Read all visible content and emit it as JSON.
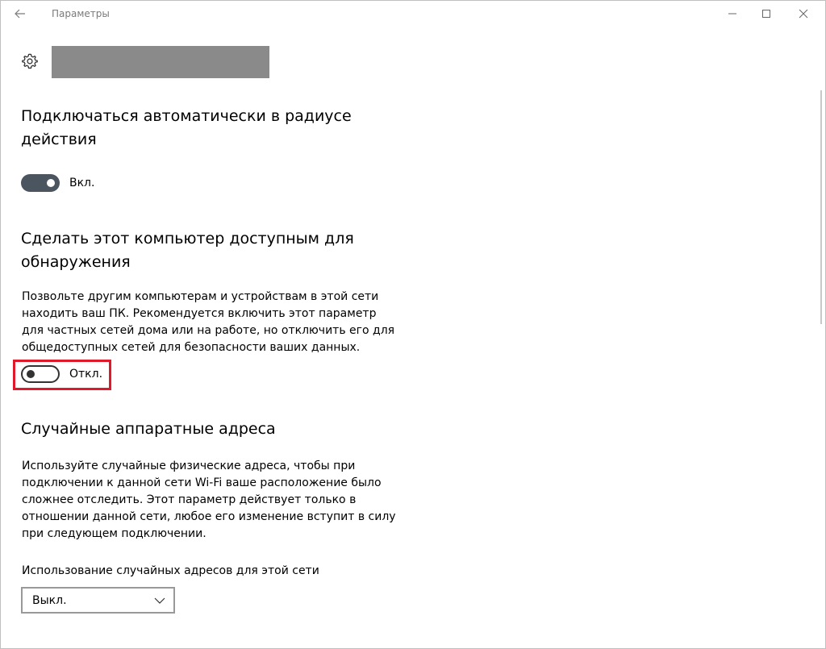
{
  "window": {
    "title": "Параметры",
    "back_icon": "arrow-left-icon",
    "controls": [
      "minimize-icon",
      "maximize-icon",
      "close-icon"
    ]
  },
  "header": {
    "icon": "gear-icon"
  },
  "auto_connect": {
    "title": "Подключаться автоматически в радиусе действия",
    "toggle_state": "on",
    "toggle_label": "Вкл."
  },
  "discoverable": {
    "title": "Сделать этот компьютер доступным для обнаружения",
    "description": "Позвольте другим компьютерам и устройствам в этой сети находить ваш ПК. Рекомендуется включить этот параметр для частных сетей дома или на работе, но отключить его для общедоступных сетей для безопасности ваших данных.",
    "toggle_state": "off",
    "toggle_label": "Откл."
  },
  "random_mac": {
    "title": "Случайные аппаратные адреса",
    "description": "Используйте случайные физические адреса, чтобы при подключении к данной сети Wi-Fi ваше расположение было сложнее отследить. Этот параметр действует только в отношении данной сети, любое его изменение вступит в силу при следующем подключении.",
    "select_label": "Использование случайных адресов для этой сети",
    "select_value": "Выкл."
  },
  "colors": {
    "toggle_on": "#4a5560",
    "highlight": "#e0192a",
    "title_text": "#7a7a7a"
  }
}
